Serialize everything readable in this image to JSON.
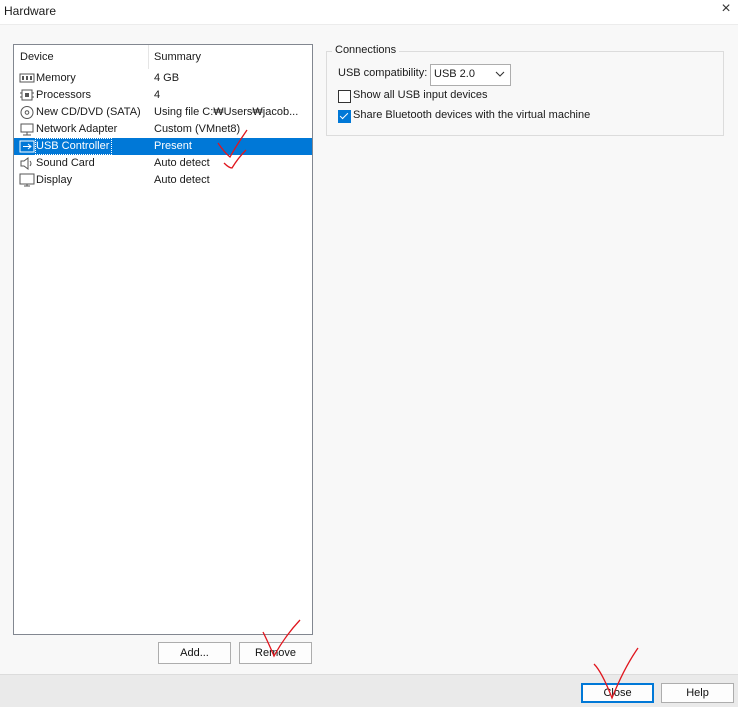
{
  "window": {
    "title": "Hardware",
    "close_glyph": "×"
  },
  "device_list": {
    "headers": {
      "device": "Device",
      "summary": "Summary"
    },
    "rows": [
      {
        "device": "Memory",
        "summary": "4 GB",
        "icon": "memory-icon",
        "selected": false
      },
      {
        "device": "Processors",
        "summary": "4",
        "icon": "processor-icon",
        "selected": false
      },
      {
        "device": "New CD/DVD (SATA)",
        "summary": "Using file C:₩Users₩jacob...",
        "icon": "cd-dvd-icon",
        "selected": false
      },
      {
        "device": "Network Adapter",
        "summary": "Custom (VMnet8)",
        "icon": "network-adapter-icon",
        "selected": false
      },
      {
        "device": "USB Controller",
        "summary": "Present",
        "icon": "usb-icon",
        "selected": true
      },
      {
        "device": "Sound Card",
        "summary": "Auto detect",
        "icon": "speaker-icon",
        "selected": false
      },
      {
        "device": "Display",
        "summary": "Auto detect",
        "icon": "monitor-icon",
        "selected": false
      }
    ]
  },
  "buttons": {
    "add": "Add...",
    "remove": "Remove",
    "close": "Close",
    "help": "Help"
  },
  "connections": {
    "group_title": "Connections",
    "usb_compat_label": "USB compatibility:",
    "usb_compat_value": "USB 2.0",
    "show_all_usb": {
      "label": "Show all USB input devices",
      "checked": false
    },
    "share_bluetooth": {
      "label": "Share Bluetooth devices with the virtual machine",
      "checked": true
    }
  },
  "colors": {
    "selection": "#0078d7",
    "annotation": "#e0161e"
  }
}
